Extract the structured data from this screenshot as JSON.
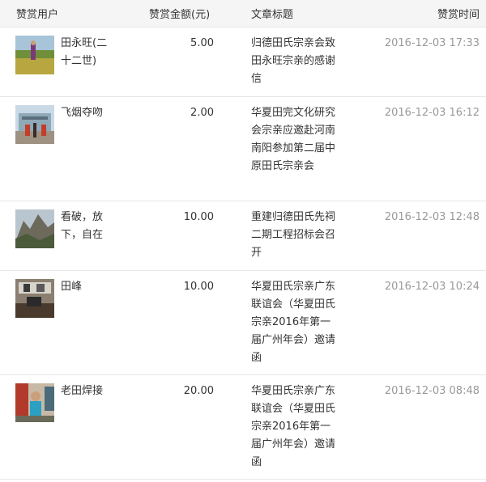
{
  "header": {
    "user": "赞赏用户",
    "amount": "赞赏金额(元)",
    "title": "文章标题",
    "time": "赞赏时间"
  },
  "rows": [
    {
      "user": "田永旺(二十二世)",
      "amount": "5.00",
      "title": "归德田氏宗亲会致田永旺宗亲的感谢信",
      "time": "2016-12-03 17:33",
      "avatar": "field-avatar-icon"
    },
    {
      "user": "飞烟夺吻",
      "amount": "2.00",
      "title": "华夏田完文化研究会宗亲应邀赴河南南阳参加第二届中原田氏宗亲会",
      "time": "2016-12-03 16:12",
      "avatar": "building-avatar-icon"
    },
    {
      "user": "看破，放下，自在",
      "amount": "10.00",
      "title": "重建归德田氏先祠二期工程招标会召开",
      "time": "2016-12-03 12:48",
      "avatar": "mountain-avatar-icon"
    },
    {
      "user": "田峰",
      "amount": "10.00",
      "title": "华夏田氏宗亲广东联谊会（华夏田氏宗亲2016年第一届广州年会）邀请函",
      "time": "2016-12-03 10:24",
      "avatar": "office-avatar-icon"
    },
    {
      "user": "老田焊接",
      "amount": "20.00",
      "title": "华夏田氏宗亲广东联谊会（华夏田氏宗亲2016年第一届广州年会）邀请函",
      "time": "2016-12-03 08:48",
      "avatar": "person-avatar-icon"
    }
  ]
}
